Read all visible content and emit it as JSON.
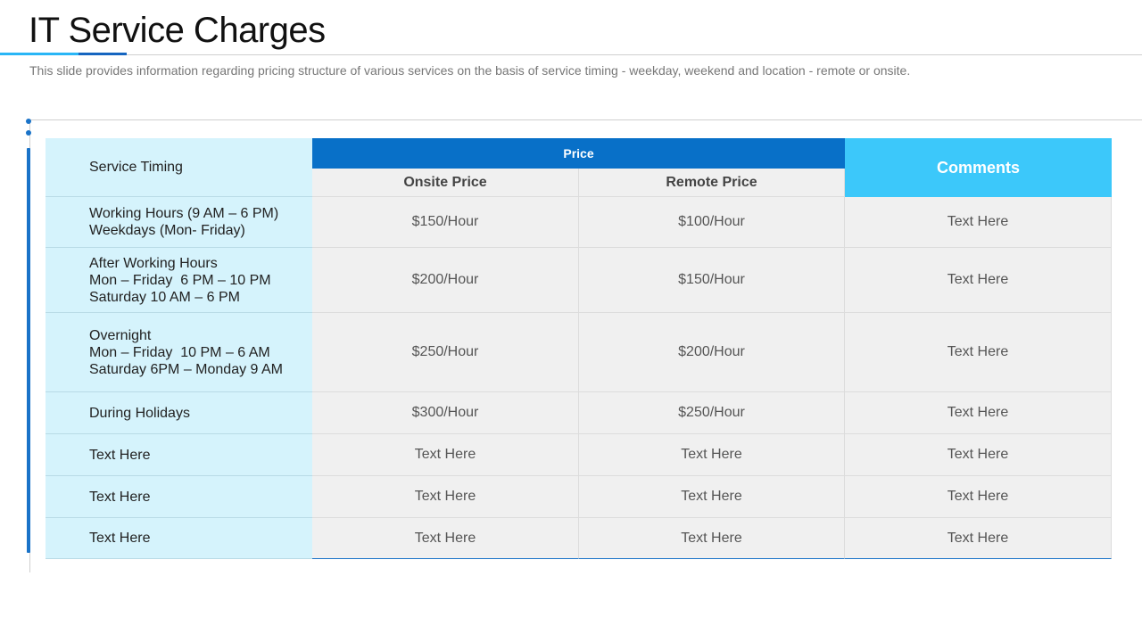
{
  "slide": {
    "title": "IT Service Charges",
    "subtitle": "This slide provides information regarding pricing structure of various services on the basis of service timing - weekday, weekend and location - remote or onsite."
  },
  "table": {
    "header": {
      "service_timing": "Service Timing",
      "price": "Price",
      "onsite": "Onsite Price",
      "remote": "Remote Price",
      "comments": "Comments"
    },
    "rows": [
      {
        "timing": [
          "Working Hours (9 AM – 6 PM)",
          "Weekdays (Mon- Friday)"
        ],
        "onsite": "$150/Hour",
        "remote": "$100/Hour",
        "comment": "Text Here"
      },
      {
        "timing": [
          "After Working Hours",
          "Mon – Friday  6 PM – 10 PM",
          "Saturday 10 AM – 6 PM"
        ],
        "onsite": "$200/Hour",
        "remote": "$150/Hour",
        "comment": "Text Here"
      },
      {
        "timing": [
          "Overnight",
          "Mon – Friday  10 PM – 6 AM",
          "Saturday 6PM – Monday 9 AM"
        ],
        "onsite": "$250/Hour",
        "remote": "$200/Hour",
        "comment": "Text Here"
      },
      {
        "timing": [
          "During Holidays"
        ],
        "onsite": "$300/Hour",
        "remote": "$250/Hour",
        "comment": "Text Here"
      },
      {
        "timing": [
          "Text Here"
        ],
        "onsite": "Text Here",
        "remote": "Text Here",
        "comment": "Text Here"
      },
      {
        "timing": [
          "Text Here"
        ],
        "onsite": "Text Here",
        "remote": "Text Here",
        "comment": "Text Here"
      },
      {
        "timing": [
          "Text Here"
        ],
        "onsite": "Text Here",
        "remote": "Text Here",
        "comment": "Text Here"
      }
    ]
  },
  "colors": {
    "price_header": "#0870c8",
    "comments_header": "#3cc8fa",
    "label_column": "#d5f3fc",
    "accent_bar": "#1a73c8"
  }
}
